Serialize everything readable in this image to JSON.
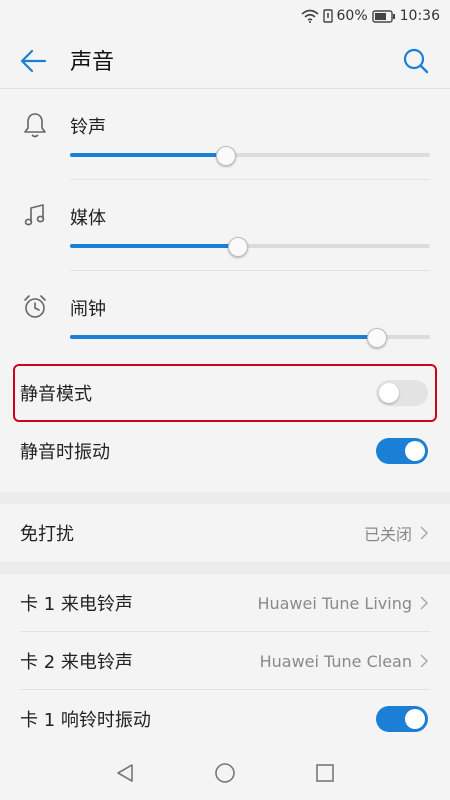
{
  "status": {
    "battery_text": "60%",
    "time": "10:36"
  },
  "header": {
    "title": "声音"
  },
  "volumes": [
    {
      "label": "铃声",
      "icon": "bell-icon",
      "level": 0.43
    },
    {
      "label": "媒体",
      "icon": "music-note-icon",
      "level": 0.465
    },
    {
      "label": "闹钟",
      "icon": "alarm-clock-icon",
      "level": 0.85
    }
  ],
  "silent_mode": {
    "label": "静音模式",
    "on": false
  },
  "vibrate_silent": {
    "label": "静音时振动",
    "on": true
  },
  "dnd": {
    "label": "免打扰",
    "value": "已关闭"
  },
  "sim1_ringtone": {
    "label": "卡 1 来电铃声",
    "value": "Huawei Tune Living"
  },
  "sim2_ringtone": {
    "label": "卡 2 来电铃声",
    "value": "Huawei Tune Clean"
  },
  "sim1_vibrate": {
    "label": "卡 1 响铃时振动",
    "on": true
  },
  "colors": {
    "accent": "#1c7fd6",
    "highlight": "#d0021b"
  }
}
